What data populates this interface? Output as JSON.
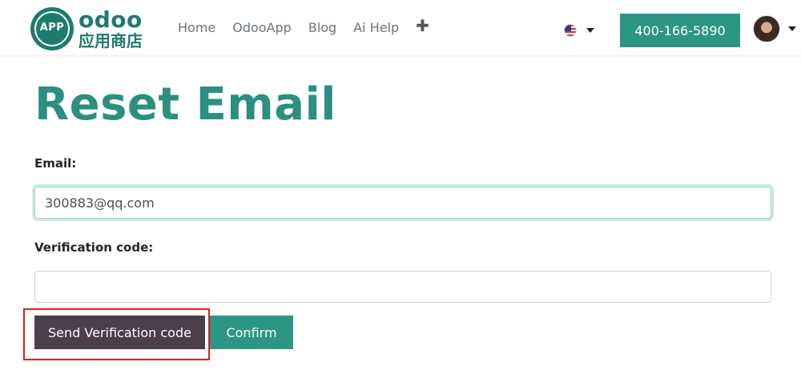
{
  "logo": {
    "badge_text": "APP",
    "word": "odoo",
    "subtitle": "应用商店"
  },
  "nav": {
    "links": [
      "Home",
      "OdooApp",
      "Blog",
      "Ai Help"
    ],
    "more_symbol": "✚"
  },
  "language": {
    "flag": "us-flag-icon"
  },
  "phone": {
    "label": "400-166-5890"
  },
  "user": {
    "avatar": "avatar"
  },
  "page": {
    "title": "Reset Email"
  },
  "form": {
    "email_label": "Email:",
    "email_value": "300883@qq.com",
    "code_label": "Verification code:",
    "code_value": "",
    "send_button": "Send Verification code",
    "confirm_button": "Confirm"
  },
  "colors": {
    "brand": "#1f7a6e",
    "accent": "#2c9583",
    "title": "#2c8f80",
    "send_button": "#4a3f4a",
    "highlight": "#e02020"
  }
}
